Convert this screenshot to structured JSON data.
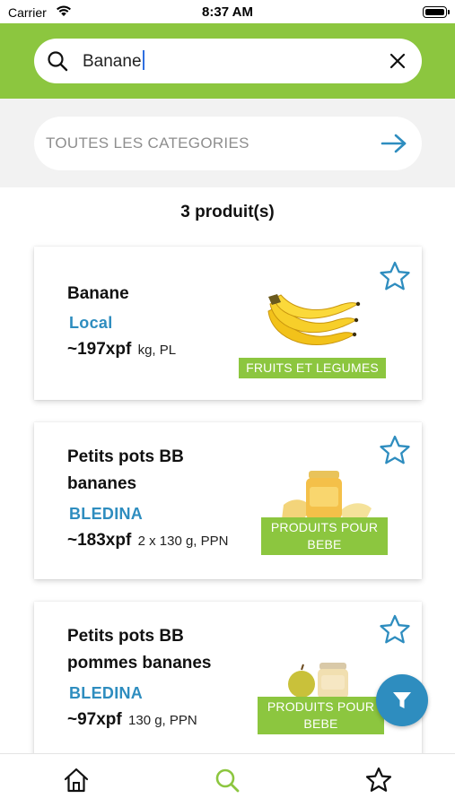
{
  "status_bar": {
    "carrier": "Carrier",
    "time": "8:37 AM"
  },
  "search": {
    "query": "Banane"
  },
  "category_filter": {
    "label": "TOUTES LES CATEGORIES"
  },
  "results": {
    "count_label": "3 produit(s)"
  },
  "products": [
    {
      "name": "Banane",
      "brand": "Local",
      "price": "~197xpf",
      "unit": "kg, PL",
      "category": "FRUITS ET LEGUMES",
      "image_icon": "banana-bunch"
    },
    {
      "name": "Petits pots BB bananes",
      "brand": "BLEDINA",
      "price": "~183xpf",
      "unit": "2 x 130 g, PPN",
      "category": "PRODUITS POUR BEBE",
      "image_icon": "baby-food-jar-banana"
    },
    {
      "name": "Petits pots BB pommes bananes",
      "brand": "BLEDINA",
      "price": "~97xpf",
      "unit": "130 g, PPN",
      "category": "PRODUITS POUR BEBE",
      "image_icon": "baby-food-jar-apple"
    }
  ],
  "tab_bar": {
    "tabs": [
      "home-icon",
      "search-icon",
      "star-icon"
    ],
    "active_color": "#8cc63f"
  },
  "colors": {
    "brand_green": "#8cc63f",
    "accent_blue": "#2e8dbf"
  }
}
